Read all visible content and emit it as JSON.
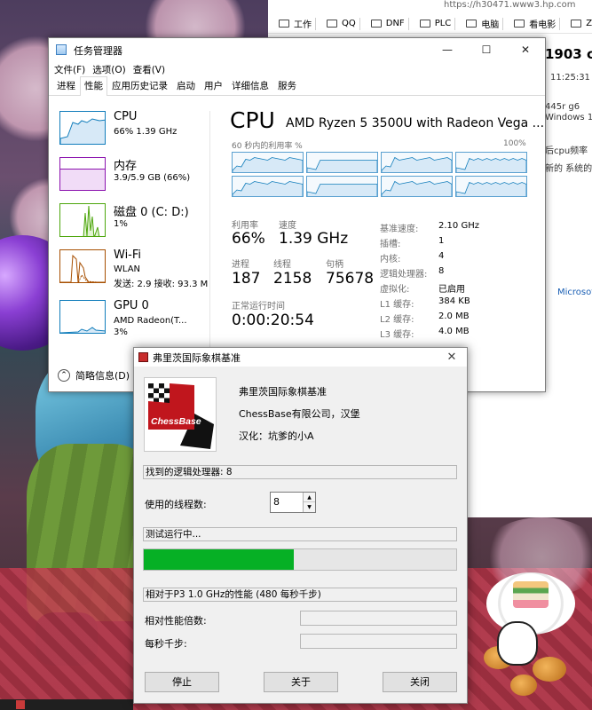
{
  "browser": {
    "url_fragment": "https://h30471.www3.hp.com",
    "bookmarks": [
      "工作",
      "QQ",
      "DNF",
      "PLC",
      "电脑",
      "看电影",
      "ZE"
    ],
    "page_title_fragment": "1903 c",
    "time_fragment": "11:25:31",
    "line_fragment_1": "445r g6",
    "line_fragment_2": "Windows 1",
    "line_fragment_3": "后cpu频率",
    "line_fragment_4": "新的 系统的",
    "link_fragment": "Microsoft"
  },
  "taskmgr": {
    "title": "任务管理器",
    "controls": {
      "minimize": "—",
      "maximize": "☐",
      "close": "✕"
    },
    "menu": [
      "文件(F)",
      "选项(O)",
      "查看(V)"
    ],
    "tabs": [
      "进程",
      "性能",
      "应用历史记录",
      "启动",
      "用户",
      "详细信息",
      "服务"
    ],
    "active_tab": "性能",
    "side": [
      {
        "name": "CPU",
        "sub1": "66% 1.39 GHz",
        "sub2": "",
        "color": "#117dbb"
      },
      {
        "name": "内存",
        "sub1": "3.9/5.9 GB (66%)",
        "sub2": "",
        "color": "#8b12ae"
      },
      {
        "name": "磁盘 0 (C: D:)",
        "sub1": "1%",
        "sub2": "",
        "color": "#4da60c"
      },
      {
        "name": "Wi-Fi",
        "sub1": "WLAN",
        "sub2": "发送: 2.9 接收: 93.3 M",
        "color": "#a74f01"
      },
      {
        "name": "GPU 0",
        "sub1": "AMD Radeon(T...",
        "sub2": "3%",
        "color": "#117dbb"
      }
    ],
    "simple_label": "简略信息(D)",
    "cpu": {
      "heading": "CPU",
      "model": "AMD Ryzen 5 3500U with Radeon Vega ...",
      "graph_label": "60 秒内的利用率 %",
      "graph_max": "100%",
      "cores": 8,
      "core_load_pct": 66,
      "stats": {
        "util_label": "利用率",
        "util": "66%",
        "speed_label": "速度",
        "speed": "1.39 GHz",
        "proc_label": "进程",
        "proc": "187",
        "thread_label": "线程",
        "thread": "2158",
        "handle_label": "句柄",
        "handle": "75678",
        "uptime_label": "正常运行时间",
        "uptime": "0:00:20:54"
      },
      "info": [
        {
          "k": "基准速度:",
          "v": "2.10 GHz"
        },
        {
          "k": "插槽:",
          "v": "1"
        },
        {
          "k": "内核:",
          "v": "4"
        },
        {
          "k": "逻辑处理器:",
          "v": "8"
        },
        {
          "k": "虚拟化:",
          "v": "已启用"
        },
        {
          "k": "L1 缓存:",
          "v": "384 KB"
        },
        {
          "k": "L2 缓存:",
          "v": "2.0 MB"
        },
        {
          "k": "L3 缓存:",
          "v": "4.0 MB"
        }
      ]
    }
  },
  "chess": {
    "title": "弗里茨国际象棋基准",
    "logo_text": "ChessBase",
    "app_name": "弗里茨国际象棋基准",
    "company": "ChessBase有限公司，汉堡",
    "localizer": "汉化：坑爹的小A",
    "found_processors": "找到的逻辑处理器: 8",
    "threads_label": "使用的线程数:",
    "threads_value": "8",
    "status": "测试运行中...",
    "progress_pct": 48,
    "relative_perf": "相对于P3 1.0 GHz的性能 (480 每秒千步)",
    "perf_ratio_label": "相对性能倍数:",
    "kn_per_sec_label": "每秒千步:",
    "buttons": {
      "stop": "停止",
      "about": "关于",
      "close": "关闭"
    },
    "progress_color": "#06b025"
  }
}
